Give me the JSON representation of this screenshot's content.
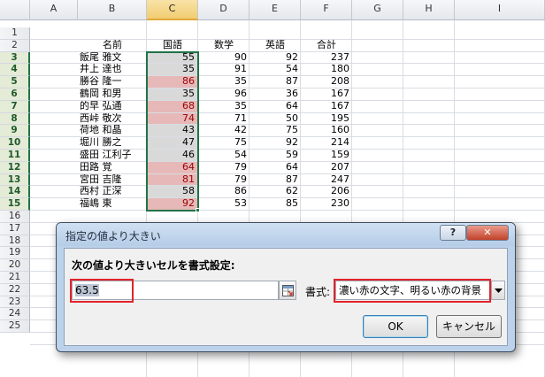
{
  "sheet": {
    "col_headers": [
      "A",
      "B",
      "C",
      "D",
      "E",
      "F",
      "G",
      "H",
      "I"
    ],
    "row_headers": [
      "1",
      "2",
      "3",
      "4",
      "5",
      "6",
      "7",
      "8",
      "9",
      "10",
      "11",
      "12",
      "13",
      "14",
      "15",
      "16",
      "17",
      "18",
      "19",
      "20",
      "21",
      "22",
      "23",
      "24",
      "25"
    ],
    "header_row": {
      "name": "名前",
      "japanese": "国語",
      "math": "数学",
      "english": "英語",
      "total": "合計"
    },
    "rows": [
      {
        "name": "飯尾 雅文",
        "japanese": "55",
        "math": "90",
        "english": "92",
        "total": "237",
        "highlight": false
      },
      {
        "name": "井上 達也",
        "japanese": "35",
        "math": "91",
        "english": "54",
        "total": "180",
        "highlight": false
      },
      {
        "name": "勝谷 隆一",
        "japanese": "86",
        "math": "35",
        "english": "87",
        "total": "208",
        "highlight": true
      },
      {
        "name": "鶴岡 和男",
        "japanese": "35",
        "math": "96",
        "english": "36",
        "total": "167",
        "highlight": false
      },
      {
        "name": "的早 弘通",
        "japanese": "68",
        "math": "35",
        "english": "64",
        "total": "167",
        "highlight": true
      },
      {
        "name": "西峠 敬次",
        "japanese": "74",
        "math": "71",
        "english": "50",
        "total": "195",
        "highlight": true
      },
      {
        "name": "荷地 和晶",
        "japanese": "43",
        "math": "42",
        "english": "75",
        "total": "160",
        "highlight": false
      },
      {
        "name": "堀川 勝之",
        "japanese": "47",
        "math": "75",
        "english": "92",
        "total": "214",
        "highlight": false
      },
      {
        "name": "盛田 江利子",
        "japanese": "46",
        "math": "54",
        "english": "59",
        "total": "159",
        "highlight": false
      },
      {
        "name": "田路 覚",
        "japanese": "64",
        "math": "79",
        "english": "64",
        "total": "207",
        "highlight": true
      },
      {
        "name": "宮田 吉隆",
        "japanese": "81",
        "math": "79",
        "english": "87",
        "total": "247",
        "highlight": true
      },
      {
        "name": "西村 正深",
        "japanese": "58",
        "math": "86",
        "english": "62",
        "total": "206",
        "highlight": false
      },
      {
        "name": "福嶋 東",
        "japanese": "92",
        "math": "53",
        "english": "85",
        "total": "230",
        "highlight": true
      }
    ],
    "colors": {
      "highlight_fill": "#e6b8b7",
      "highlight_text": "#9c0006",
      "selection_fill": "#d9d9d9",
      "selection_border": "#217346"
    }
  },
  "dialog": {
    "title": "指定の値より大きい",
    "help_label": "?",
    "close_label": "✕",
    "instruction": "次の値より大きいセルを書式設定:",
    "value": "63.5",
    "format_label": "書式:",
    "format_value": "濃い赤の文字、明るい赤の背景",
    "ok_label": "OK",
    "cancel_label": "キャンセル",
    "ref_icon": "range-select-icon",
    "dropdown_icon": "chevron-down-icon"
  }
}
